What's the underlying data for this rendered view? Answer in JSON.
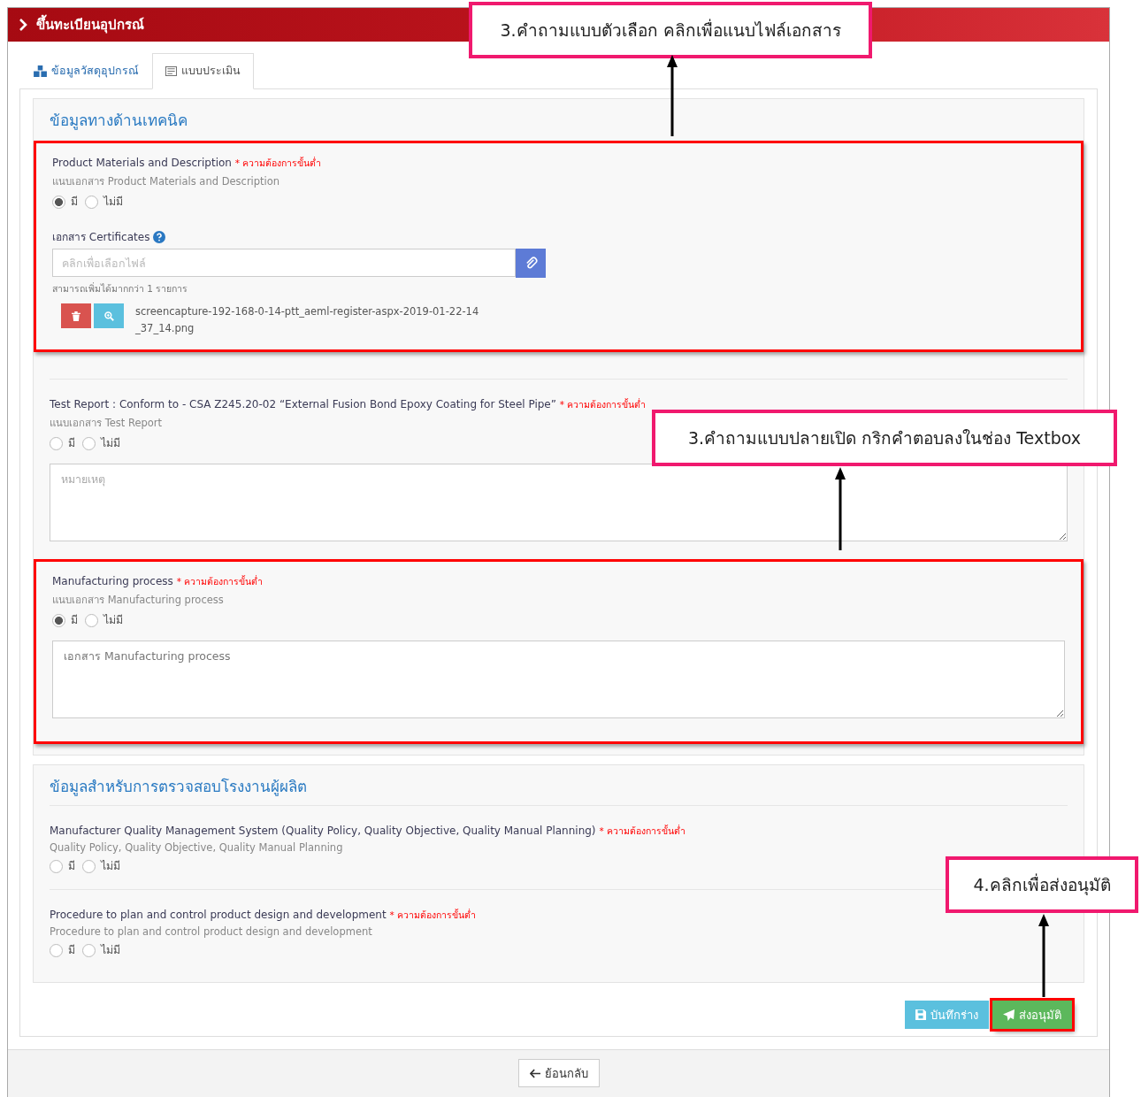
{
  "header": {
    "title": "ขึ้นทะเบียนอุปกรณ์"
  },
  "tabs": [
    {
      "label": "ข้อมูลวัสดุอุปกรณ์",
      "selected": false
    },
    {
      "label": "แบบประเมิน",
      "selected": true
    }
  ],
  "sections": [
    {
      "title": "ข้อมูลทางด้านเทคนิค",
      "questions": [
        {
          "kind": "file",
          "highlighted": true,
          "label": "Product Materials and Description",
          "required": "* ความต้องการขั้นต่ำ",
          "hint": "แนบเอกสาร Product Materials and Description",
          "options": [
            {
              "label": "มี",
              "selected": true
            },
            {
              "label": "ไม่มี",
              "selected": false
            }
          ],
          "file_label": "เอกสาร Certificates",
          "file_placeholder": "คลิกเพื่อเลือกไฟล์",
          "file_note": "สามารถเพิ่มได้มากกว่า 1 รายการ",
          "files": [
            "screencapture-192-168-0-14-ptt_aeml-register-aspx-2019-01-22-14_37_14.png"
          ]
        },
        {
          "kind": "text",
          "highlighted": false,
          "label": "Test Report : Conform to - CSA Z245.20-02 “External Fusion Bond Epoxy Coating for Steel Pipe”",
          "required": "* ความต้องการขั้นต่ำ",
          "hint": "แนบเอกสาร Test Report",
          "options": [
            {
              "label": "มี",
              "selected": false
            },
            {
              "label": "ไม่มี",
              "selected": false
            }
          ],
          "placeholder": "หมายเหตุ"
        },
        {
          "kind": "text",
          "highlighted": true,
          "label": "Manufacturing process",
          "required": "* ความต้องการขั้นต่ำ",
          "hint": "แนบเอกสาร Manufacturing process",
          "options": [
            {
              "label": "มี",
              "selected": true
            },
            {
              "label": "ไม่มี",
              "selected": false
            }
          ],
          "value": "เอกสาร Manufacturing process"
        }
      ]
    },
    {
      "title": "ข้อมูลสำหรับการตรวจสอบโรงงานผู้ผลิต",
      "questions": [
        {
          "kind": "choice",
          "highlighted": false,
          "label": "Manufacturer Quality Management System (Quality Policy, Quality Objective, Quality Manual Planning)",
          "required": "* ความต้องการขั้นต่ำ",
          "hint": "Quality Policy, Quality Objective, Quality Manual Planning",
          "options": [
            {
              "label": "มี",
              "selected": false
            },
            {
              "label": "ไม่มี",
              "selected": false
            }
          ]
        },
        {
          "kind": "choice",
          "highlighted": false,
          "label": "Procedure to plan and control product design and development",
          "required": "* ความต้องการขั้นต่ำ",
          "hint": "Procedure to plan and control product design and development",
          "options": [
            {
              "label": "มี",
              "selected": false
            },
            {
              "label": "ไม่มี",
              "selected": false
            }
          ]
        }
      ]
    }
  ],
  "actions": [
    {
      "kind": "draft",
      "label": "บันทึกร่าง",
      "highlighted": false
    },
    {
      "kind": "submit",
      "label": "ส่งอนุมัติ",
      "highlighted": true
    }
  ],
  "back_button": {
    "label": "ย้อนกลับ"
  },
  "annotations": [
    {
      "text": "3.คำถามแบบตัวเลือก คลิกเพื่อแนบไฟล์เอกสาร"
    },
    {
      "text": "3.คำถามแบบปลายเปิด กริกคำตอบลงในช่อง Textbox"
    },
    {
      "text": "4.คลิกเพื่อส่งอนุมัติ"
    }
  ]
}
